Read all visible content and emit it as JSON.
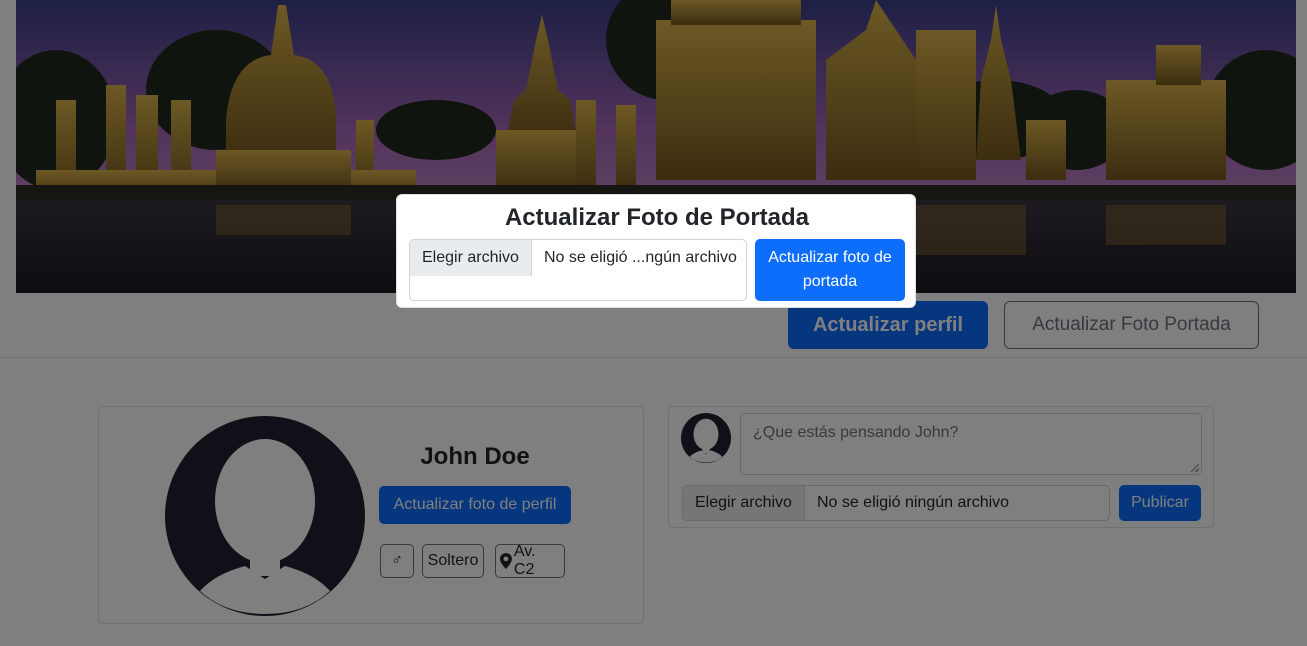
{
  "cover": {
    "image": "temple-ruins-at-dusk"
  },
  "actions": {
    "update_profile": "Actualizar perfil",
    "update_cover": "Actualizar Foto Portada"
  },
  "profile": {
    "name": "John Doe",
    "update_photo_button": "Actualizar foto de perfil",
    "gender_icon": "male-icon",
    "gender_symbol": "♂",
    "status": "Soltero",
    "address_icon": "map-marker-icon",
    "address": "Av. C2"
  },
  "post": {
    "placeholder": "¿Que estás pensando John?",
    "file_button": "Elegir archivo",
    "file_name": "No se eligió ningún archivo",
    "publish_button": "Publicar"
  },
  "modal": {
    "title": "Actualizar Foto de Portada",
    "file_button": "Elegir archivo",
    "file_name": "No se eligió ...ngún archivo",
    "submit_button": "Actualizar foto de portada"
  },
  "colors": {
    "primary": "#0d6efd",
    "secondary": "#6c757d",
    "avatar": "#212230"
  }
}
